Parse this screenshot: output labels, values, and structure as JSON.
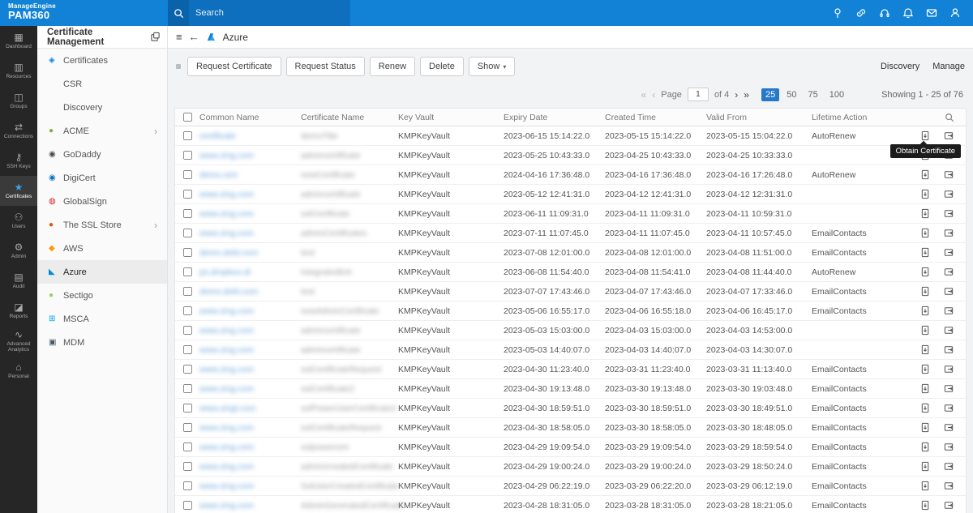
{
  "topbar": {
    "brand_line1": "ManageEngine",
    "brand_line2": "PAM360",
    "search_placeholder": "Search",
    "icons": [
      "pin-icon",
      "link-icon",
      "headset-icon",
      "bell-icon",
      "mail-icon",
      "user-icon"
    ]
  },
  "left_nav": {
    "items": [
      {
        "name": "rail-item-dashboard",
        "label": "Dashboard",
        "icon": "▦",
        "active": false
      },
      {
        "name": "rail-item-resources",
        "label": "Resources",
        "icon": "▥",
        "active": false
      },
      {
        "name": "rail-item-groups",
        "label": "Groups",
        "icon": "◫",
        "active": false
      },
      {
        "name": "rail-item-connections",
        "label": "Connections",
        "icon": "⇄",
        "active": false
      },
      {
        "name": "rail-item-ssh-keys",
        "label": "SSH Keys",
        "icon": "⚷",
        "active": false
      },
      {
        "name": "rail-item-certificates",
        "label": "Certificates",
        "icon": "★",
        "active": true
      },
      {
        "name": "rail-item-users",
        "label": "Users",
        "icon": "⚇",
        "active": false
      },
      {
        "name": "rail-item-admin",
        "label": "Admin",
        "icon": "⚙",
        "active": false
      },
      {
        "name": "rail-item-audit",
        "label": "Audit",
        "icon": "▤",
        "active": false
      },
      {
        "name": "rail-item-reports",
        "label": "Reports",
        "icon": "◪",
        "active": false
      },
      {
        "name": "rail-item-advanced-analytics",
        "label": "Advanced Analytics",
        "icon": "∿",
        "active": false
      },
      {
        "name": "rail-item-personal",
        "label": "Personal",
        "icon": "⌂",
        "active": false
      }
    ]
  },
  "sidebar": {
    "title": "Certificate Management",
    "items": [
      {
        "name": "sidebar-item-certificates",
        "label": "Certificates",
        "icon": "◈",
        "color": "#1287d9",
        "chevron": "",
        "active": false
      },
      {
        "name": "sidebar-item-csr",
        "label": "CSR",
        "icon": "",
        "color": "",
        "chevron": "",
        "active": false
      },
      {
        "name": "sidebar-item-discovery",
        "label": "Discovery",
        "icon": "",
        "color": "",
        "chevron": "",
        "active": false
      },
      {
        "name": "sidebar-item-acme",
        "label": "ACME",
        "icon": "●",
        "color": "#7cb342",
        "chevron": "›",
        "active": false
      },
      {
        "name": "sidebar-item-godaddy",
        "label": "GoDaddy",
        "icon": "◉",
        "color": "#4a4a4a",
        "chevron": "",
        "active": false
      },
      {
        "name": "sidebar-item-digicert",
        "label": "DigiCert",
        "icon": "◉",
        "color": "#0174c3",
        "chevron": "",
        "active": false
      },
      {
        "name": "sidebar-item-globalsign",
        "label": "GlobalSign",
        "icon": "◍",
        "color": "#d8232a",
        "chevron": "",
        "active": false
      },
      {
        "name": "sidebar-item-ssl-store",
        "label": "The SSL Store",
        "icon": "●",
        "color": "#e65100",
        "chevron": "›",
        "active": false
      },
      {
        "name": "sidebar-item-aws",
        "label": "AWS",
        "icon": "◆",
        "color": "#ff9900",
        "chevron": "",
        "active": false
      },
      {
        "name": "sidebar-item-azure",
        "label": "Azure",
        "icon": "◣",
        "color": "#0089d6",
        "chevron": "",
        "active": true
      },
      {
        "name": "sidebar-item-sectigo",
        "label": "Sectigo",
        "icon": "●",
        "color": "#9ccc65",
        "chevron": "",
        "active": false
      },
      {
        "name": "sidebar-item-msca",
        "label": "MSCA",
        "icon": "⊞",
        "color": "#00a4ef",
        "chevron": "",
        "active": false
      },
      {
        "name": "sidebar-item-mdm",
        "label": "MDM",
        "icon": "▣",
        "color": "#455a64",
        "chevron": "",
        "active": false
      }
    ]
  },
  "main": {
    "breadcrumb": "Azure",
    "toolbar": {
      "buttons": [
        {
          "name": "request-certificate-button",
          "label": "Request Certificate"
        },
        {
          "name": "request-status-button",
          "label": "Request Status"
        },
        {
          "name": "renew-button",
          "label": "Renew"
        },
        {
          "name": "delete-button",
          "label": "Delete"
        }
      ],
      "show_label": "Show",
      "show_caret": "▾"
    },
    "links": [
      {
        "name": "discovery-link",
        "label": "Discovery"
      },
      {
        "name": "manage-link",
        "label": "Manage"
      }
    ],
    "pagination": {
      "first": "«",
      "prev": "‹",
      "page_label": "Page",
      "page": "1",
      "of_label": "of 4",
      "next": "›",
      "last": "»",
      "sizes": [
        {
          "label": "25",
          "active": true
        },
        {
          "label": "50",
          "active": false
        },
        {
          "label": "75",
          "active": false
        },
        {
          "label": "100",
          "active": false
        }
      ],
      "showing": "Showing 1 - 25 of 76"
    },
    "tooltip": "Obtain Certificate",
    "table": {
      "headers": [
        "Common Name",
        "Certificate Name",
        "Key Vault",
        "Expiry Date",
        "Created Time",
        "Valid From",
        "Lifetime Action"
      ],
      "rows": [
        {
          "common": "certificate",
          "cert": "demoTitle",
          "vault": "KMPKeyVault",
          "expiry": "2023-06-15 15:14:22.0",
          "created": "2023-05-15 15:14:22.0",
          "valid": "2023-05-15 15:04:22.0",
          "action": "AutoRenew"
        },
        {
          "common": "www.zing.com",
          "cert": "admincertificate",
          "vault": "KMPKeyVault",
          "expiry": "2023-05-25 10:43:33.0",
          "created": "2023-04-25 10:43:33.0",
          "valid": "2023-04-25 10:33:33.0",
          "action": ""
        },
        {
          "common": "demo.cert",
          "cert": "newCertificate",
          "vault": "KMPKeyVault",
          "expiry": "2024-04-16 17:36:48.0",
          "created": "2023-04-16 17:36:48.0",
          "valid": "2023-04-16 17:26:48.0",
          "action": "AutoRenew"
        },
        {
          "common": "www.zing.com",
          "cert": "admincertificate",
          "vault": "KMPKeyVault",
          "expiry": "2023-05-12 12:41:31.0",
          "created": "2023-04-12 12:41:31.0",
          "valid": "2023-04-12 12:31:31.0",
          "action": ""
        },
        {
          "common": "www.zing.com",
          "cert": "sslCertificate",
          "vault": "KMPKeyVault",
          "expiry": "2023-06-11 11:09:31.0",
          "created": "2023-04-11 11:09:31.0",
          "valid": "2023-04-11 10:59:31.0",
          "action": ""
        },
        {
          "common": "www.zing.com",
          "cert": "adminCertificates",
          "vault": "KMPKeyVault",
          "expiry": "2023-07-11 11:07:45.0",
          "created": "2023-04-11 11:07:45.0",
          "valid": "2023-04-11 10:57:45.0",
          "action": "EmailContacts"
        },
        {
          "common": "demo.debt.com",
          "cert": "test",
          "vault": "KMPKeyVault",
          "expiry": "2023-07-08 12:01:00.0",
          "created": "2023-04-08 12:01:00.0",
          "valid": "2023-04-08 11:51:00.0",
          "action": "EmailContacts"
        },
        {
          "common": "ps.dropbox.di",
          "cert": "integrateditch",
          "vault": "KMPKeyVault",
          "expiry": "2023-06-08 11:54:40.0",
          "created": "2023-04-08 11:54:41.0",
          "valid": "2023-04-08 11:44:40.0",
          "action": "AutoRenew"
        },
        {
          "common": "demo.debt.com",
          "cert": "test",
          "vault": "KMPKeyVault",
          "expiry": "2023-07-07 17:43:46.0",
          "created": "2023-04-07 17:43:46.0",
          "valid": "2023-04-07 17:33:46.0",
          "action": "EmailContacts"
        },
        {
          "common": "www.zing.com",
          "cert": "newAdminCertificate",
          "vault": "KMPKeyVault",
          "expiry": "2023-05-06 16:55:17.0",
          "created": "2023-04-06 16:55:18.0",
          "valid": "2023-04-06 16:45:17.0",
          "action": "EmailContacts"
        },
        {
          "common": "www.zing.com",
          "cert": "admincertificate",
          "vault": "KMPKeyVault",
          "expiry": "2023-05-03 15:03:00.0",
          "created": "2023-04-03 15:03:00.0",
          "valid": "2023-04-03 14:53:00.0",
          "action": ""
        },
        {
          "common": "www.zing.com",
          "cert": "admincertificate",
          "vault": "KMPKeyVault",
          "expiry": "2023-05-03 14:40:07.0",
          "created": "2023-04-03 14:40:07.0",
          "valid": "2023-04-03 14:30:07.0",
          "action": ""
        },
        {
          "common": "www.zing.com",
          "cert": "sslCertificateRequest",
          "vault": "KMPKeyVault",
          "expiry": "2023-04-30 11:23:40.0",
          "created": "2023-03-31 11:23:40.0",
          "valid": "2023-03-31 11:13:40.0",
          "action": "EmailContacts"
        },
        {
          "common": "www.zing.com",
          "cert": "sslCertificate2",
          "vault": "KMPKeyVault",
          "expiry": "2023-04-30 19:13:48.0",
          "created": "2023-03-30 19:13:48.0",
          "valid": "2023-03-30 19:03:48.0",
          "action": "EmailContacts"
        },
        {
          "common": "www.zingl.com",
          "cert": "sslPowerUserCertificate2",
          "vault": "KMPKeyVault",
          "expiry": "2023-04-30 18:59:51.0",
          "created": "2023-03-30 18:59:51.0",
          "valid": "2023-03-30 18:49:51.0",
          "action": "EmailContacts"
        },
        {
          "common": "www.zing.com",
          "cert": "sslCertificateRequest",
          "vault": "KMPKeyVault",
          "expiry": "2023-04-30 18:58:05.0",
          "created": "2023-03-30 18:58:05.0",
          "valid": "2023-03-30 18:48:05.0",
          "action": "EmailContacts"
        },
        {
          "common": "www.zing.com",
          "cert": "sslpowercert",
          "vault": "KMPKeyVault",
          "expiry": "2023-04-29 19:09:54.0",
          "created": "2023-03-29 19:09:54.0",
          "valid": "2023-03-29 18:59:54.0",
          "action": "EmailContacts"
        },
        {
          "common": "www.zing.com",
          "cert": "admin/createdCertificate",
          "vault": "KMPKeyVault",
          "expiry": "2023-04-29 19:00:24.0",
          "created": "2023-03-29 19:00:24.0",
          "valid": "2023-03-29 18:50:24.0",
          "action": "EmailContacts"
        },
        {
          "common": "www.zing.com",
          "cert": "SslUserCreatedCertificate",
          "vault": "KMPKeyVault",
          "expiry": "2023-04-29 06:22:19.0",
          "created": "2023-03-29 06:22:20.0",
          "valid": "2023-03-29 06:12:19.0",
          "action": "EmailContacts"
        },
        {
          "common": "www.zing.com",
          "cert": "AdminGeneratedCertificate",
          "vault": "KMPKeyVault",
          "expiry": "2023-04-28 18:31:05.0",
          "created": "2023-03-28 18:31:05.0",
          "valid": "2023-03-28 18:21:05.0",
          "action": "EmailContacts"
        }
      ]
    }
  }
}
